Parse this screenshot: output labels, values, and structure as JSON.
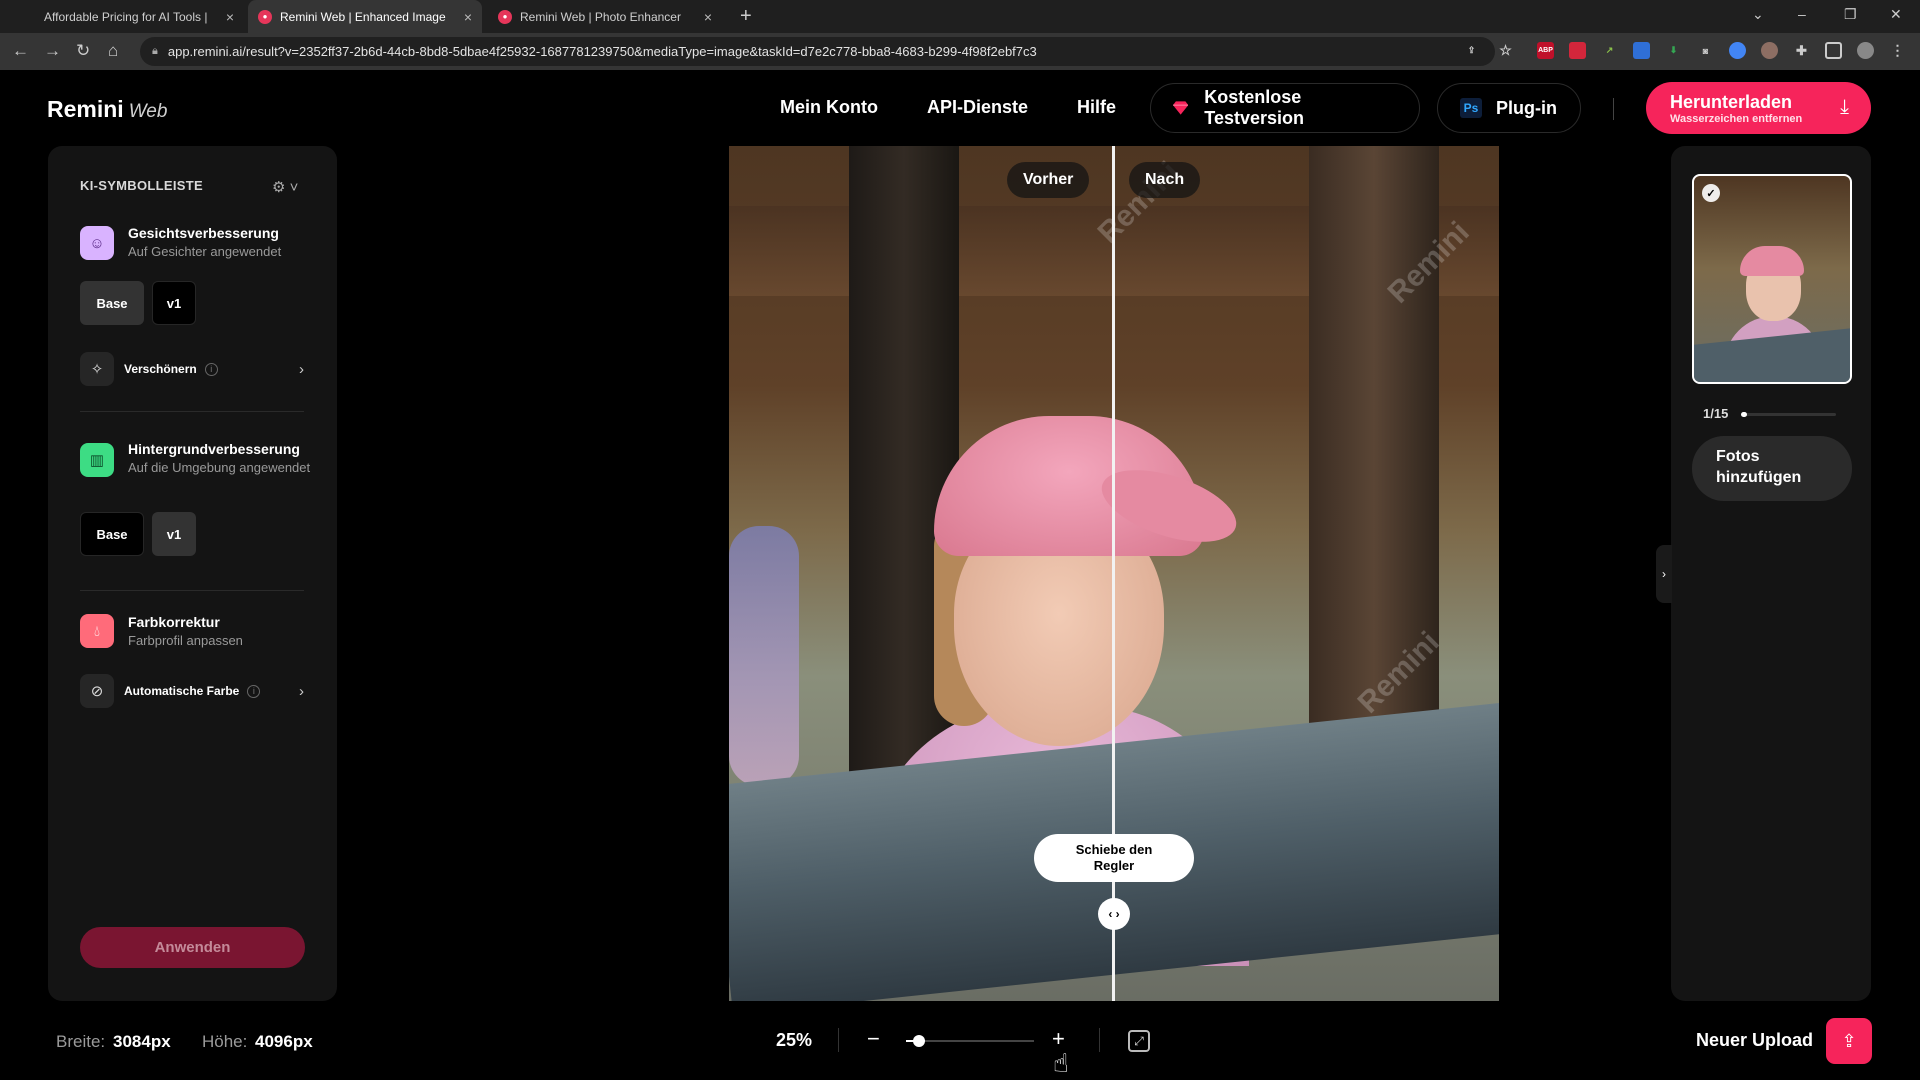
{
  "browser": {
    "tabs": [
      {
        "title": "Affordable Pricing for AI Tools | ",
        "active": false
      },
      {
        "title": "Remini Web | Enhanced Image",
        "active": true
      },
      {
        "title": "Remini Web | Photo Enhancer",
        "active": false
      }
    ],
    "url": "app.remini.ai/result?v=2352ff37-2b6d-44cb-8bd8-5dbae4f25932-1687781239750&mediaType=image&taskId=d7e2c778-bba8-4683-b299-4f98f2ebf7c3",
    "extensions": [
      "ABP",
      "ext-red",
      "ext-arrow",
      "ext-blue",
      "ext-green",
      "ext-camera",
      "ext-chrome",
      "ext-brown",
      "puzzle",
      "sidebar",
      "profile"
    ]
  },
  "header": {
    "logo": "Remini",
    "logo_suffix": "Web",
    "nav": [
      "Mein Konto",
      "API-Dienste",
      "Hilfe"
    ],
    "trial_label": "Kostenlose Testversion",
    "plugin_label": "Plug-in",
    "plugin_badge": "Ps",
    "download_label": "Herunterladen",
    "download_sub": "Wasserzeichen entfernen"
  },
  "sidebar": {
    "title": "KI-SYMBOLLEISTE",
    "face": {
      "title": "Gesichtsverbesserung",
      "subtitle": "Auf Gesichter angewendet",
      "options": [
        "Base",
        "v1"
      ]
    },
    "beautify": {
      "label": "Verschönern"
    },
    "background": {
      "title": "Hintergrundverbesserung",
      "subtitle": "Auf die Umgebung angewendet",
      "options": [
        "Base",
        "v1"
      ]
    },
    "color": {
      "title": "Farbkorrektur",
      "subtitle": "Farbprofil anpassen"
    },
    "auto_color": {
      "label": "Automatische Farbe"
    },
    "apply_label": "Anwenden"
  },
  "viewer": {
    "before_label": "Vorher",
    "after_label": "Nach",
    "slider_tip": "Schiebe den Regler",
    "watermark": "Remini",
    "slider_position": 0.5
  },
  "right_panel": {
    "counter": "1/15",
    "add_photos": "Fotos hinzufügen"
  },
  "footer": {
    "width_label": "Breite:",
    "width_value": "3084px",
    "height_label": "Höhe:",
    "height_value": "4096px",
    "zoom": "25%",
    "zoom_fraction": 0.1,
    "new_upload": "Neuer Upload"
  },
  "colors": {
    "accent": "#f6245b",
    "panel": "#141414"
  }
}
